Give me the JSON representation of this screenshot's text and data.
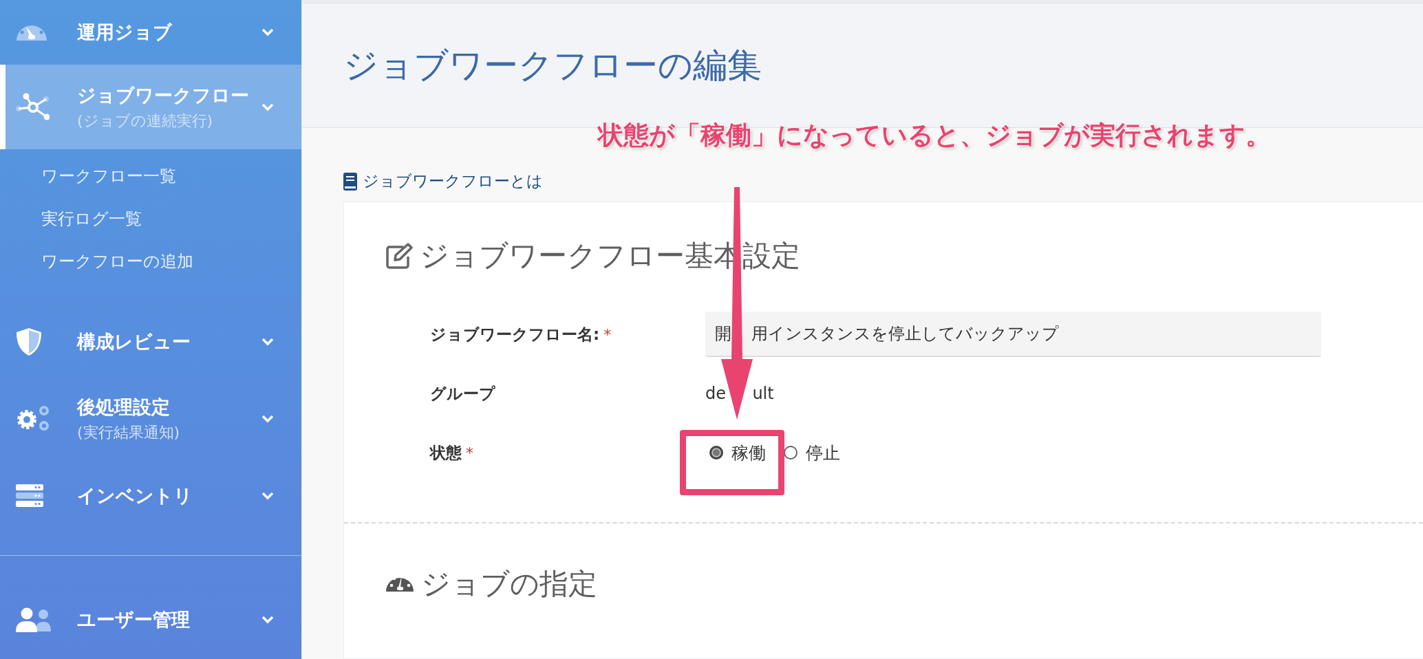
{
  "sidebar": {
    "items": [
      {
        "label": "運用ジョブ",
        "selected": false
      },
      {
        "label": "ジョブワークフロー",
        "sublabel": "(ジョブの連続実行)",
        "selected": true,
        "children": [
          {
            "label": "ワークフロー一覧"
          },
          {
            "label": "実行ログ一覧"
          },
          {
            "label": "ワークフローの追加"
          }
        ]
      },
      {
        "label": "構成レビュー",
        "selected": false
      },
      {
        "label": "後処理設定",
        "sublabel": "(実行結果通知)",
        "selected": false
      },
      {
        "label": "インベントリ",
        "selected": false
      },
      {
        "label": "ユーザー管理",
        "selected": false
      }
    ]
  },
  "page": {
    "title": "ジョブワークフローの編集",
    "help_link": "ジョブワークフローとは"
  },
  "annotation": {
    "text": "状態が「稼働」になっていると、ジョブが実行されます。"
  },
  "basic_settings": {
    "title": "ジョブワークフロー基本設定",
    "fields": [
      {
        "kind": "input",
        "label": "ジョブワークフロー名:",
        "required_mark": "*",
        "value_parts": [
          "開",
          "用インスタンスを停止してバックアップ"
        ]
      },
      {
        "kind": "text",
        "label": "グループ",
        "value_parts": [
          "de",
          "ult"
        ]
      },
      {
        "kind": "radio",
        "label": "状態",
        "required_mark": "*",
        "options": [
          {
            "label": "稼働",
            "selected": true
          },
          {
            "label": "停止",
            "selected": false
          }
        ]
      }
    ]
  },
  "job_section": {
    "title": "ジョブの指定"
  }
}
